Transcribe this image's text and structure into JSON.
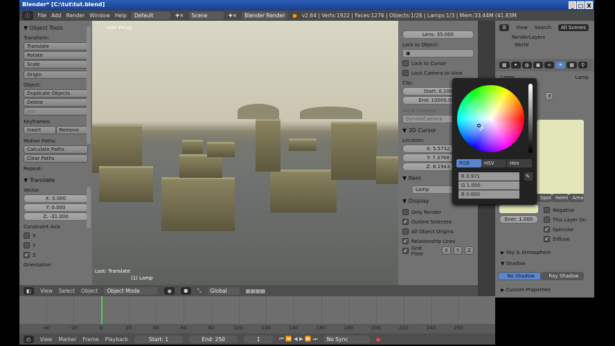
{
  "window": {
    "title": "Blender* [C:\\tut\\tut.blend]",
    "min": "_",
    "max": "□",
    "close": "X"
  },
  "header": {
    "menus": [
      "File",
      "Add",
      "Render",
      "Window",
      "Help"
    ],
    "screen": "Default",
    "scene": "Scene",
    "engine": "Blender Render",
    "stats": "v2.64 | Verts:1922 | Faces:1276 | Objects:1/26 | Lamps:1/3 | Mem:33.44M (41.83M"
  },
  "toolshelf": {
    "title": "Object Tools",
    "transform_label": "Transform:",
    "translate": "Translate",
    "rotate": "Rotate",
    "scale": "Scale",
    "origin": "Origin",
    "object_label": "Object:",
    "duplicate": "Duplicate Objects",
    "delete": "Delete",
    "join": "Join",
    "keyframes_label": "Keyframes:",
    "insert": "Insert",
    "remove": "Remove",
    "motion_label": "Motion Paths:",
    "calc_paths": "Calculate Paths",
    "clear_paths": "Clear Paths",
    "repeat_label": "Repeat:",
    "op_title": "Translate",
    "vector_label": "Vector",
    "x": "X: 0.000",
    "y": "Y: 0.000",
    "z": "Z: -31.000",
    "constraint_label": "Constraint Axis",
    "cx": "X",
    "cy": "Y",
    "cz": "Z",
    "orientation_label": "Orientation"
  },
  "viewport": {
    "view_name": "User Persp",
    "last_op": "Last: Translate",
    "object": "(1) Lamp"
  },
  "npanel": {
    "lens": "Lens: 35.000",
    "lock_object_label": "Lock to Object:",
    "lock_cursor": "Lock to Cursor",
    "lock_camera": "Lock Camera to View",
    "clip_label": "Clip:",
    "clip_start": "Start: 0.100",
    "clip_end": "End: 10000.000",
    "local_camera_label": "Local Camera:",
    "local_camera": "DynamCamera",
    "cursor_title": "3D Cursor",
    "location_label": "Location:",
    "cx": "X: 5.5732",
    "cy": "Y: 7.3768",
    "cz": "Z: 8.1943",
    "item_title": "Item",
    "item_name": "Lamp",
    "display_title": "Display",
    "only_render": "Only Render",
    "outline_selected": "Outline Selected",
    "all_origins": "All Object Origins",
    "relationship": "Relationship Lines",
    "grid_floor": "Grid Floor",
    "gx": "X",
    "gy": "Y",
    "gz": "Z"
  },
  "outliner": {
    "view": "View",
    "search": "Search",
    "filter": "All Scenes",
    "items": [
      "RenderLayers",
      "World"
    ]
  },
  "props": {
    "crumb1": "Lamp",
    "crumb2": "Lamp",
    "f": "F",
    "types": [
      "Spot",
      "Hemi",
      "Area"
    ],
    "energy": "Ener: 1.000",
    "negative": "Negative",
    "this_layer": "This Layer On",
    "specular": "Specular",
    "diffuse": "Diffuse",
    "sky": "Sky & Atmosphere",
    "shadow": "Shadow",
    "no_shadow": "No Shadow",
    "ray_shadow": "Ray Shadow",
    "custom": "Custom Properties",
    "lamp_color": "#e3e6b9"
  },
  "picker": {
    "modes": [
      "RGB",
      "HSV",
      "Hex"
    ],
    "r": "R 0.971",
    "g": "G 1.000",
    "b": "B 0.600",
    "r_val": 0.971,
    "g_val": 1.0,
    "b_val": 0.6
  },
  "vpheader": {
    "menus": [
      "View",
      "Select",
      "Object"
    ],
    "mode": "Object Mode",
    "orientation": "Global"
  },
  "timeline": {
    "ticks": [
      "-40",
      "-20",
      "0",
      "20",
      "40",
      "60",
      "80",
      "100",
      "120",
      "140",
      "160",
      "180",
      "200",
      "220",
      "240",
      "260"
    ],
    "current_frame_value": 0
  },
  "tlheader": {
    "menus": [
      "View",
      "Marker",
      "Frame",
      "Playback"
    ],
    "start": "Start: 1",
    "end": "End: 250",
    "frame": "1",
    "sync": "No Sync"
  }
}
